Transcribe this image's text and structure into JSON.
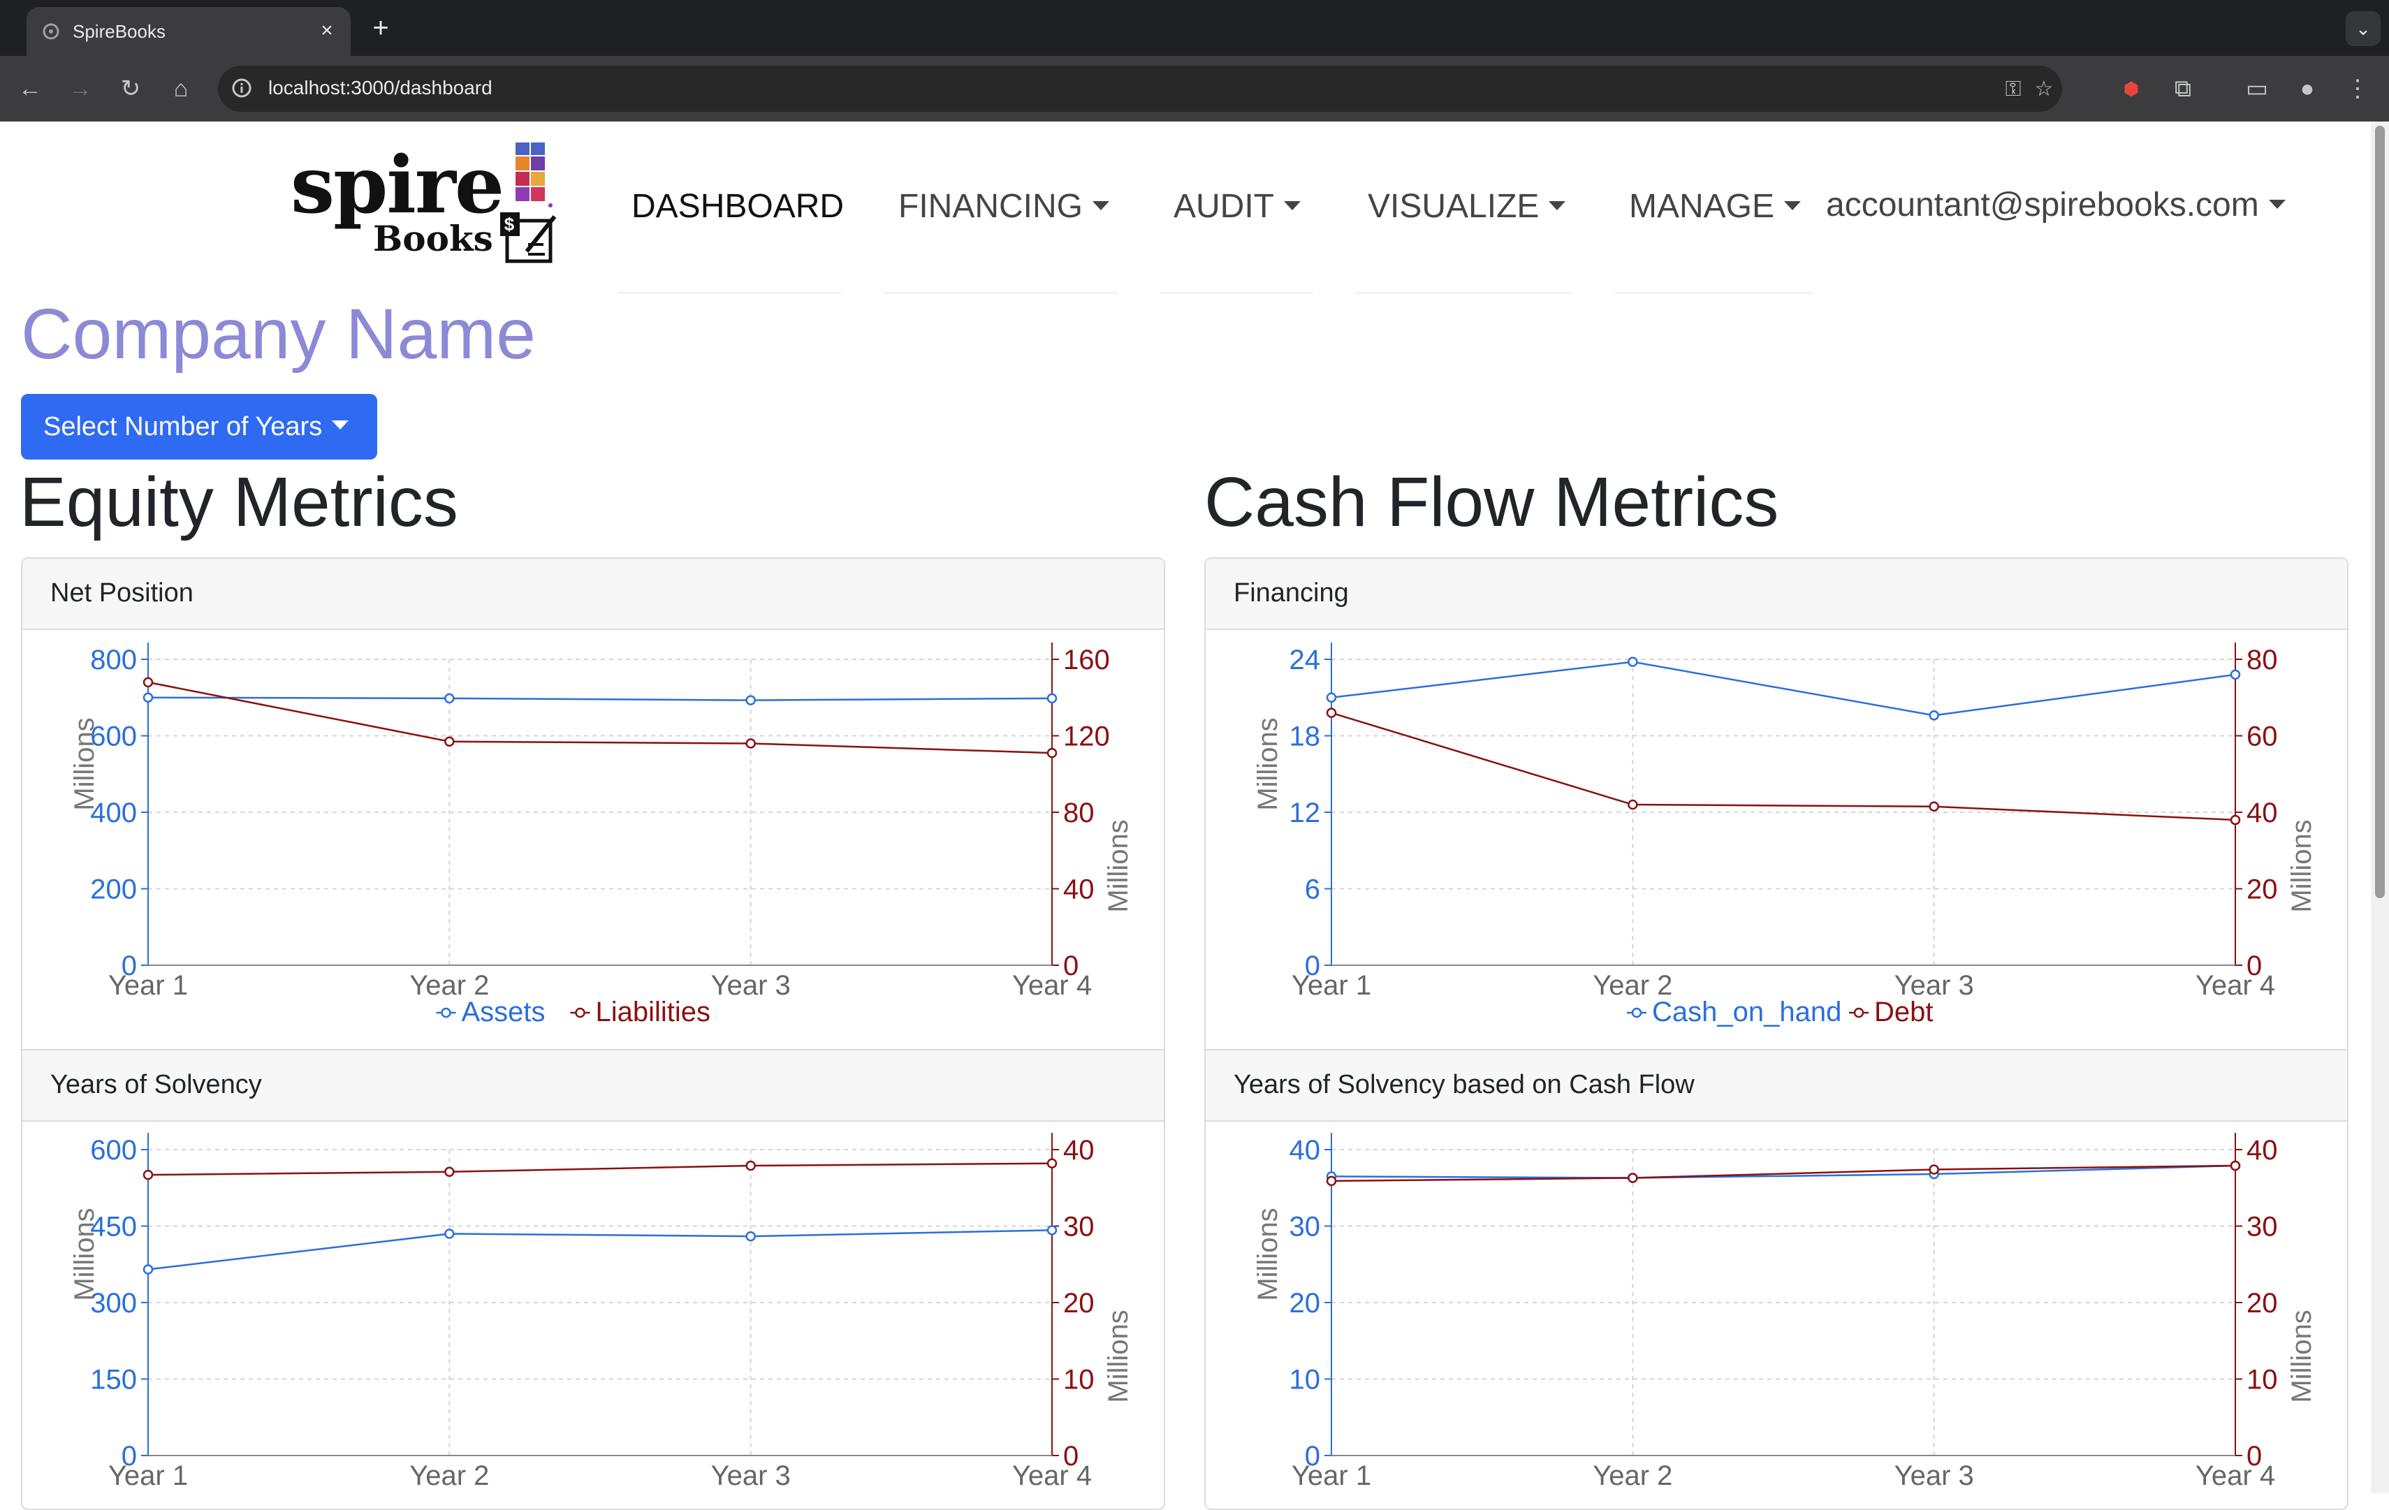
{
  "browser": {
    "tab_title": "SpireBooks",
    "url": "localhost:3000/dashboard"
  },
  "logo": {
    "word": "spire",
    "sub": "Books",
    "badge": "$"
  },
  "nav": {
    "items": [
      {
        "label": "DASHBOARD",
        "dropdown": false
      },
      {
        "label": "FINANCING",
        "dropdown": true
      },
      {
        "label": "AUDIT",
        "dropdown": true
      },
      {
        "label": "VISUALIZE",
        "dropdown": true
      },
      {
        "label": "MANAGE",
        "dropdown": true
      }
    ],
    "account": "accountant@spirebooks.com"
  },
  "company_name": "Company Name",
  "years_button": "Select Number of Years",
  "sections": {
    "equity": "Equity Metrics",
    "cashflow": "Cash Flow Metrics"
  },
  "colors": {
    "left_series": "#2a6fdb",
    "right_series": "#8b1010",
    "primary": "#2f6bf2",
    "company": "#8c8ad6"
  },
  "cards": {
    "net_position": "Net Position",
    "financing": "Financing",
    "solvency": "Years of Solvency",
    "solvency_cf": "Years of Solvency based on Cash Flow"
  },
  "chart_data": [
    {
      "type": "line",
      "title": "Net Position",
      "categories": [
        "Year 1",
        "Year 2",
        "Year 3",
        "Year 4"
      ],
      "series": [
        {
          "name": "Assets",
          "axis": "left",
          "values": [
            700,
            698,
            693,
            698
          ]
        },
        {
          "name": "Liabilities",
          "axis": "right",
          "values": [
            148,
            117,
            116,
            111
          ]
        }
      ],
      "ylabel_left": "Millions",
      "ylabel_right": "Millions",
      "yticks_left": [
        0,
        200,
        400,
        600,
        800
      ],
      "ylim_left": [
        0,
        800
      ],
      "yticks_right": [
        0,
        40,
        80,
        120,
        160
      ],
      "ylim_right": [
        0,
        160
      ],
      "legend": "bottom",
      "grid": true
    },
    {
      "type": "line",
      "title": "Financing",
      "categories": [
        "Year 1",
        "Year 2",
        "Year 3",
        "Year 4"
      ],
      "series": [
        {
          "name": "Cash_on_hand",
          "axis": "left",
          "values": [
            21,
            23.8,
            19.6,
            22.8
          ]
        },
        {
          "name": "Debt",
          "axis": "right",
          "values": [
            66,
            42,
            41.5,
            38
          ]
        }
      ],
      "ylabel_left": "Millions",
      "ylabel_right": "Millions",
      "yticks_left": [
        0,
        6,
        12,
        18,
        24
      ],
      "ylim_left": [
        0,
        24
      ],
      "yticks_right": [
        0,
        20,
        40,
        60,
        80
      ],
      "ylim_right": [
        0,
        80
      ],
      "legend": "bottom",
      "grid": true
    },
    {
      "type": "line",
      "title": "Years of Solvency",
      "categories": [
        "Year 1",
        "Year 2",
        "Year 3",
        "Year 4"
      ],
      "series": [
        {
          "name": "",
          "axis": "left",
          "values": [
            365,
            435,
            430,
            442
          ]
        },
        {
          "name": "",
          "axis": "right",
          "values": [
            36.7,
            37.1,
            37.9,
            38.2
          ]
        }
      ],
      "ylabel_left": "Millions",
      "ylabel_right": "Millions",
      "yticks_left": [
        0,
        150,
        300,
        450,
        600
      ],
      "ylim_left": [
        0,
        600
      ],
      "yticks_right": [
        0,
        10,
        20,
        30,
        40
      ],
      "ylim_right": [
        0,
        40
      ],
      "grid": true
    },
    {
      "type": "line",
      "title": "Years of Solvency based on Cash Flow",
      "categories": [
        "Year 1",
        "Year 2",
        "Year 3",
        "Year 4"
      ],
      "series": [
        {
          "name": "",
          "axis": "left",
          "values": [
            36.5,
            36.3,
            36.8,
            37.9
          ]
        },
        {
          "name": "",
          "axis": "right",
          "values": [
            35.9,
            36.3,
            37.4,
            37.9
          ]
        }
      ],
      "ylabel_left": "Millions",
      "ylabel_right": "Millions",
      "yticks_left": [
        0,
        10,
        20,
        30,
        40
      ],
      "ylim_left": [
        0,
        40
      ],
      "yticks_right": [
        0,
        10,
        20,
        30,
        40
      ],
      "ylim_right": [
        0,
        40
      ],
      "grid": true
    }
  ]
}
